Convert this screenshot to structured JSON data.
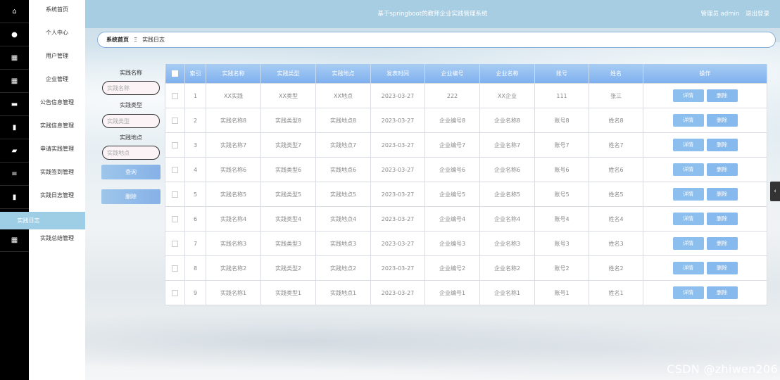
{
  "header": {
    "title": "基于springboot的教师企业实践管理系统",
    "user_label": "管理员 admin",
    "logout_label": "退出登录"
  },
  "sidebar": {
    "items": [
      {
        "label": "系统首页",
        "icon": "home-icon"
      },
      {
        "label": "个人中心",
        "icon": "user-icon"
      },
      {
        "label": "用户管理",
        "icon": "grid-icon"
      },
      {
        "label": "企业管理",
        "icon": "grid-icon"
      },
      {
        "label": "公告信息管理",
        "icon": "monitor-icon"
      },
      {
        "label": "实践信息管理",
        "icon": "clipboard-icon"
      },
      {
        "label": "申请实践管理",
        "icon": "ticket-icon"
      },
      {
        "label": "实践签到管理",
        "icon": "list-icon"
      },
      {
        "label": "实践日志管理",
        "icon": "chart-icon"
      },
      {
        "label": "实践总结管理",
        "icon": "grid-icon"
      }
    ],
    "active_label": "实践日志"
  },
  "breadcrumb": {
    "home": "系统首页",
    "sep": "Ξ",
    "current": "实践日志"
  },
  "search": {
    "name_label": "实践名称",
    "name_placeholder": "实践名称",
    "type_label": "实践类型",
    "type_placeholder": "实践类型",
    "place_label": "实践地点",
    "place_placeholder": "实践地点",
    "query_button": "查询",
    "delete_button": "删除"
  },
  "table": {
    "headers": [
      "索引",
      "实践名称",
      "实践类型",
      "实践地点",
      "发表时间",
      "企业编号",
      "企业名称",
      "账号",
      "姓名",
      "操作"
    ],
    "detail_label": "详情",
    "delete_label": "删除",
    "rows": [
      [
        "1",
        "XX实践",
        "XX类型",
        "XX地点",
        "2023-03-27",
        "222",
        "XX企业",
        "111",
        "张三"
      ],
      [
        "2",
        "实践名称8",
        "实践类型8",
        "实践地点8",
        "2023-03-27",
        "企业编号8",
        "企业名称8",
        "账号8",
        "姓名8"
      ],
      [
        "3",
        "实践名称7",
        "实践类型7",
        "实践地点7",
        "2023-03-27",
        "企业编号7",
        "企业名称7",
        "账号7",
        "姓名7"
      ],
      [
        "4",
        "实践名称6",
        "实践类型6",
        "实践地点6",
        "2023-03-27",
        "企业编号6",
        "企业名称6",
        "账号6",
        "姓名6"
      ],
      [
        "5",
        "实践名称5",
        "实践类型5",
        "实践地点5",
        "2023-03-27",
        "企业编号5",
        "企业名称5",
        "账号5",
        "姓名5"
      ],
      [
        "6",
        "实践名称4",
        "实践类型4",
        "实践地点4",
        "2023-03-27",
        "企业编号4",
        "企业名称4",
        "账号4",
        "姓名4"
      ],
      [
        "7",
        "实践名称3",
        "实践类型3",
        "实践地点3",
        "2023-03-27",
        "企业编号3",
        "企业名称3",
        "账号3",
        "姓名3"
      ],
      [
        "8",
        "实践名称2",
        "实践类型2",
        "实践地点2",
        "2023-03-27",
        "企业编号2",
        "企业名称2",
        "账号2",
        "姓名2"
      ],
      [
        "9",
        "实践名称1",
        "实践类型1",
        "实践地点1",
        "2023-03-27",
        "企业编号1",
        "企业名称1",
        "账号1",
        "姓名1"
      ]
    ]
  },
  "watermark": "CSDN @zhiwen206"
}
